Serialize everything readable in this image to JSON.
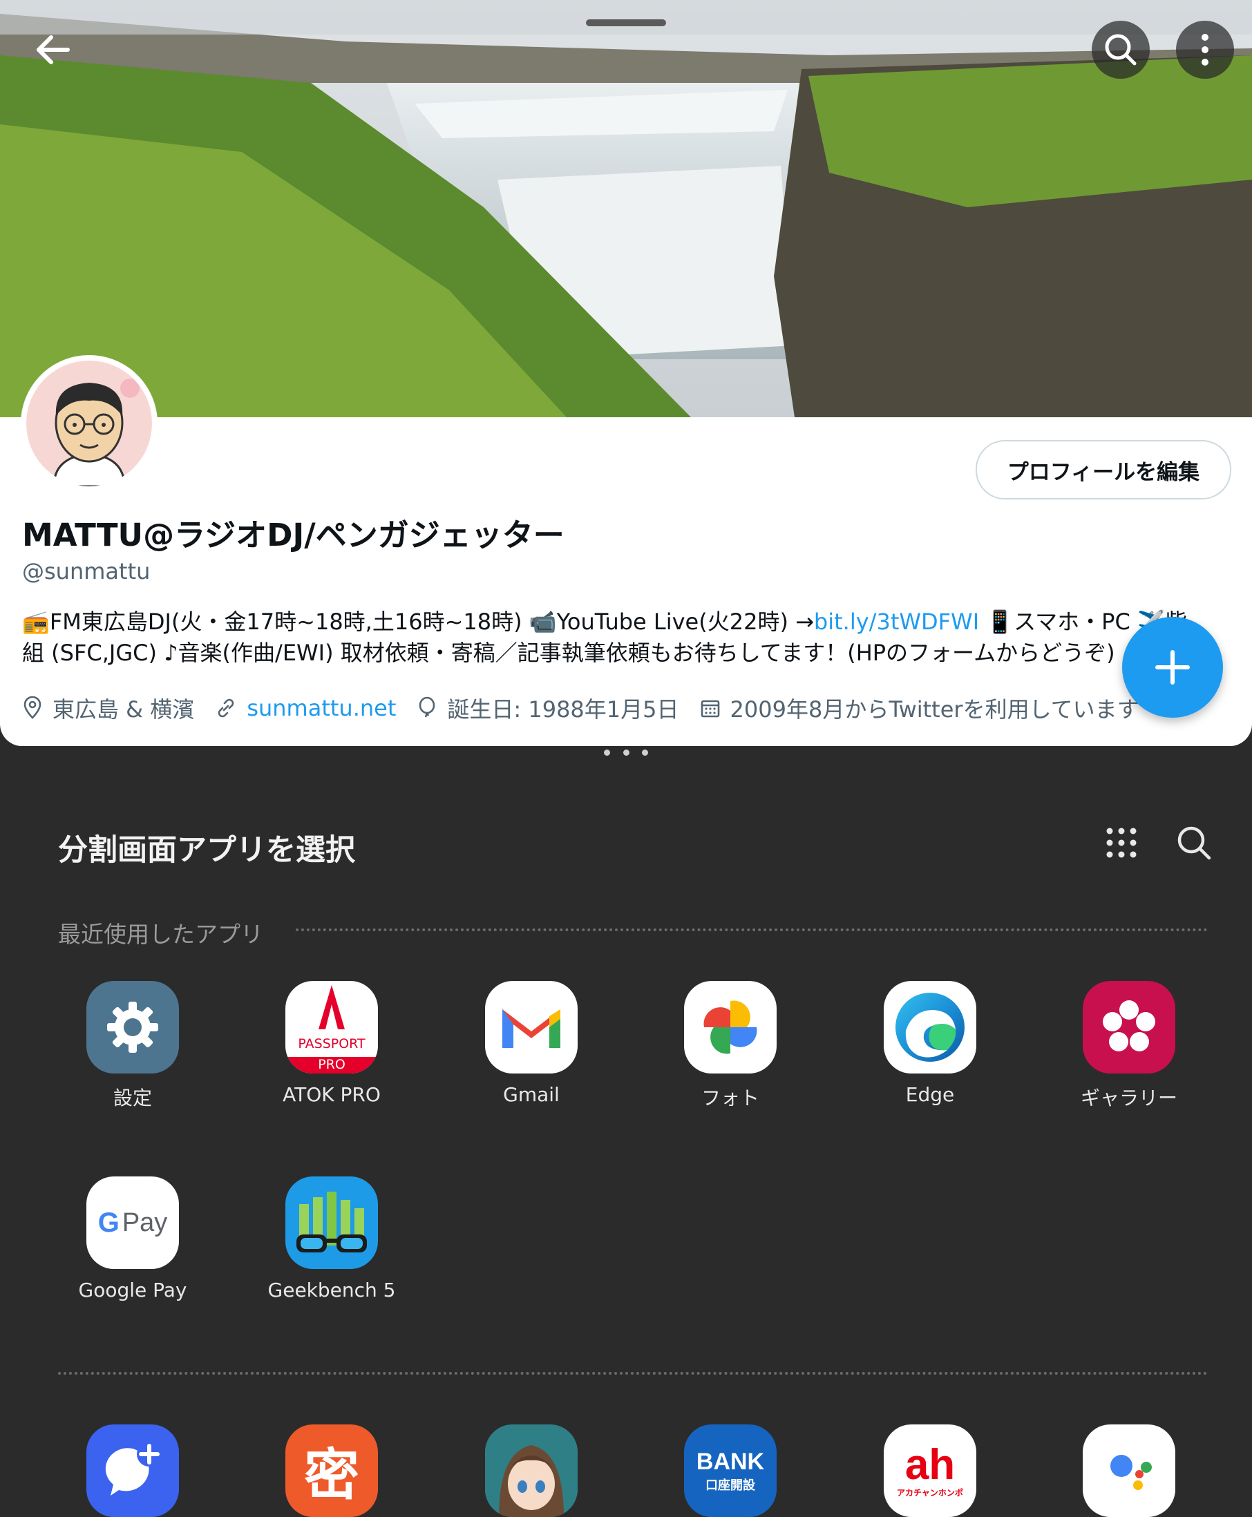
{
  "profile": {
    "edit_button": "プロフィールを編集",
    "name": "MATTU@ラジオDJ/ペンガジェッター",
    "handle": "@sunmattu",
    "bio_part1": "📻FM東広島DJ(火・金17時~18時,土16時~18時) 📹YouTube Live(火22時) →",
    "bio_link": "bit.ly/3tWDFWI",
    "bio_part2": " 📱スマホ・PC ✈️紫組 (SFC,JGC) ♪音楽(作曲/EWI) 取材依頼・寄稿／記事執筆依頼もお待ちしてます！(HPのフォームからどうぞ)",
    "location": "東広島 & 横濱",
    "website": "sunmattu.net",
    "birthday": "誕生日: 1988年1月5日",
    "joined": "2009年8月からTwitterを利用しています"
  },
  "split_panel": {
    "title": "分割画面アプリを選択",
    "recent_label": "最近使用したアプリ",
    "recent_apps": [
      {
        "label": "設定",
        "icon": "settings-icon"
      },
      {
        "label": "ATOK PRO",
        "icon": "atok-passport-icon",
        "icon_text_1": "PASSPORT",
        "icon_text_2": "PRO"
      },
      {
        "label": "Gmail",
        "icon": "gmail-icon"
      },
      {
        "label": "フォト",
        "icon": "google-photos-icon"
      },
      {
        "label": "Edge",
        "icon": "edge-icon"
      },
      {
        "label": "ギャラリー",
        "icon": "gallery-icon"
      },
      {
        "label": "Google Pay",
        "icon": "google-pay-icon",
        "icon_text": "Pay"
      },
      {
        "label": "Geekbench 5",
        "icon": "geekbench-icon"
      }
    ],
    "more_apps": [
      {
        "icon": "messages-plus-icon"
      },
      {
        "icon": "mitsu-icon",
        "icon_text": "密"
      },
      {
        "icon": "anime-girl-app-icon"
      },
      {
        "icon": "bank-icon",
        "icon_text_1": "BANK",
        "icon_text_2": "口座開設"
      },
      {
        "icon": "akachan-honpo-icon",
        "icon_text_1": "ah",
        "icon_text_2": "アカチャンホンポ"
      },
      {
        "icon": "google-assistant-icon"
      }
    ]
  },
  "colors": {
    "twitter_blue": "#1d9bf0",
    "panel_bg": "#2b2b2b"
  }
}
